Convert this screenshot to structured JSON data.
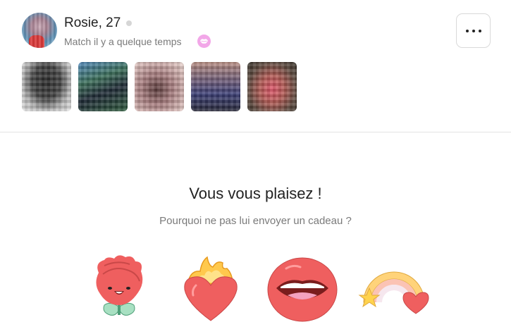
{
  "profile": {
    "name": "Rosie, 27",
    "match_text": "Match il y a quelque temps",
    "avatar_icon": "avatar",
    "status": "offline",
    "badge_icon": "kiss-icon",
    "photos": [
      "photo-1",
      "photo-2",
      "photo-3",
      "photo-4",
      "photo-5"
    ]
  },
  "actions": {
    "more_icon": "more-options-icon"
  },
  "gift_section": {
    "title": "Vous vous plaisez !",
    "subtitle": "Pourquoi ne pas lui envoyer un cadeau ?",
    "gifts": [
      "rose",
      "flaming-heart",
      "lips",
      "rainbow"
    ]
  },
  "colors": {
    "badge": "#f2a7e8",
    "gift_red": "#ef5f5f",
    "divider": "#e3e3e3"
  }
}
